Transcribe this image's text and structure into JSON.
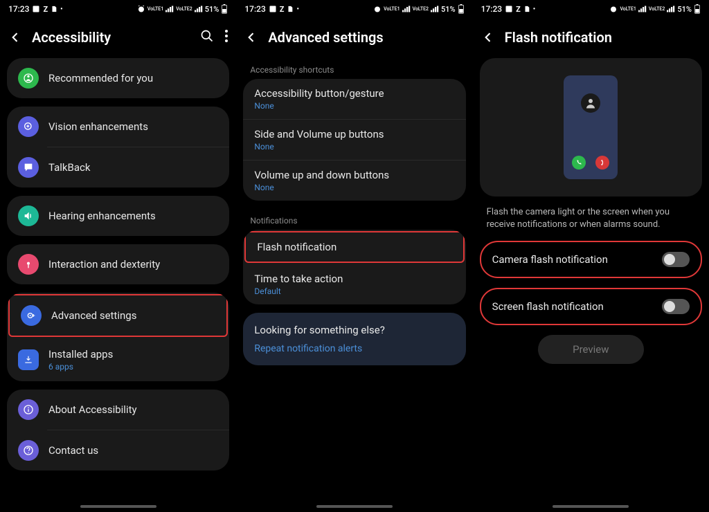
{
  "status": {
    "time": "17:23",
    "battery": "51%"
  },
  "screen1": {
    "title": "Accessibility",
    "items": {
      "recommended": "Recommended for you",
      "vision": "Vision enhancements",
      "talkback": "TalkBack",
      "hearing": "Hearing enhancements",
      "interaction": "Interaction and dexterity",
      "advanced": "Advanced settings",
      "installed": "Installed apps",
      "installed_sub": "6 apps",
      "about": "About Accessibility",
      "contact": "Contact us"
    }
  },
  "screen2": {
    "title": "Advanced settings",
    "section1": "Accessibility shortcuts",
    "rows": {
      "button_gesture": "Accessibility button/gesture",
      "button_gesture_sub": "None",
      "side_vol": "Side and Volume up buttons",
      "side_vol_sub": "None",
      "vol_updown": "Volume up and down buttons",
      "vol_updown_sub": "None"
    },
    "section2": "Notifications",
    "flash": "Flash notification",
    "time_action": "Time to take action",
    "time_action_sub": "Default",
    "looking_title": "Looking for something else?",
    "looking_link": "Repeat notification alerts"
  },
  "screen3": {
    "title": "Flash notification",
    "desc": "Flash the camera light or the screen when you receive notifications or when alarms sound.",
    "camera_flash": "Camera flash notification",
    "screen_flash": "Screen flash notification",
    "preview": "Preview"
  }
}
